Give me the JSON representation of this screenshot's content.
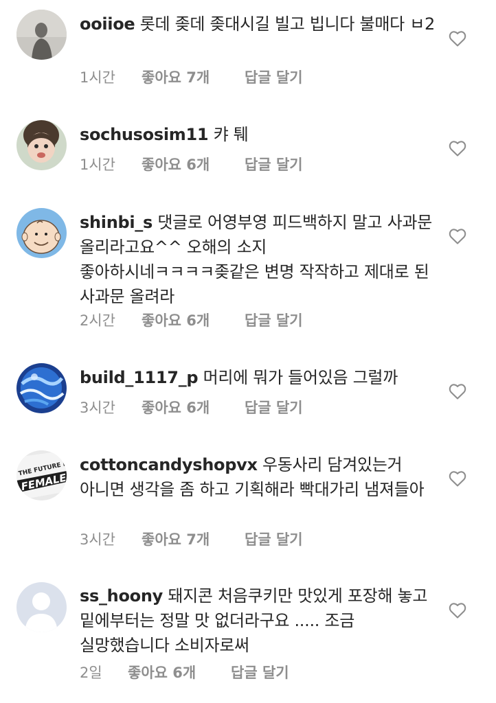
{
  "comments": [
    {
      "username": "ooiioe",
      "text": "롯데 좆데 좆대시길 빌고 빕니다 불매다 ㅂ2",
      "time": "1시간",
      "likes": "좋아요 7개",
      "reply": "답글 달기",
      "avatar_icon": "silhouette-photo-avatar"
    },
    {
      "username": "sochusosim11",
      "text": "캬 퉤",
      "time": "1시간",
      "likes": "좋아요 6개",
      "reply": "답글 달기",
      "avatar_icon": "child-photo-avatar"
    },
    {
      "username": "shinbi_s",
      "text": "댓글로 어영부영 피드백하지 말고 사과문 올리라고요^^ 오해의 소지 좋아하시네ㅋㅋㅋㅋ좆같은 변명 작작하고 제대로 된 사과문 올려라",
      "time": "2시간",
      "likes": "좋아요 6개",
      "reply": "답글 달기",
      "avatar_icon": "cartoon-boy-avatar"
    },
    {
      "username": "build_1117_p",
      "text": "머리에 뭐가 들어있음 그럴까",
      "time": "3시간",
      "likes": "좋아요 6개",
      "reply": "답글 달기",
      "avatar_icon": "blue-globe-avatar"
    },
    {
      "username": "cottoncandyshopvx",
      "text": "우동사리 담겨있는거 아니면 생각을 좀 하고 기획해라 빡대가리 냄져들아",
      "time": "3시간",
      "likes": "좋아요 7개",
      "reply": "답글 달기",
      "avatar_icon": "text-shirt-avatar",
      "avatar_text_1": "THE FUTURE IS",
      "avatar_text_2": "FEMALE"
    },
    {
      "username": "ss_hoony",
      "text": "돼지콘 처음쿠키만 맛있게 포장해 놓고  밑에부터는 정말 맛 없더라구요 ..... 조금 실망했습니다 소비자로써",
      "time": "2일",
      "likes": "좋아요 6개",
      "reply": "답글 달기",
      "avatar_icon": "default-user-avatar"
    }
  ],
  "colors": {
    "text": "#262626",
    "meta": "#8e8e8e",
    "heart": "#8e8e8e"
  }
}
